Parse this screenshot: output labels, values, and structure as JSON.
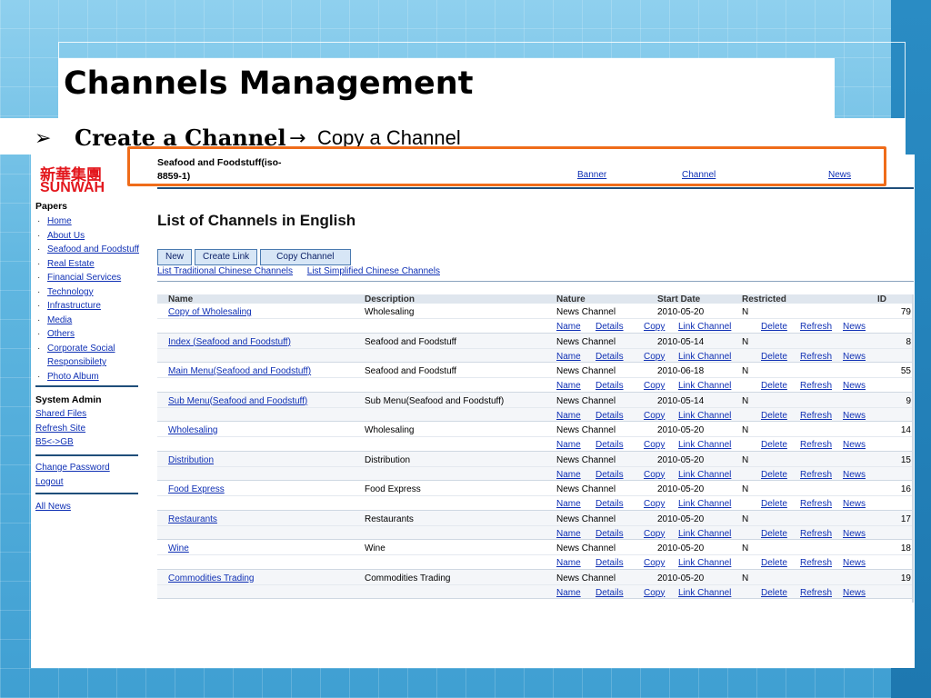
{
  "slide": {
    "title": "Channels Management",
    "bullet_arrow": "➢",
    "bullet_main": "Create a Channel",
    "sub_arrow": "→",
    "bullet_sub": "Copy a Channel"
  },
  "logo": {
    "chinese": "新華集團",
    "english": "SUNWAH"
  },
  "sidebar": {
    "papers_heading": "Papers",
    "papers": [
      "Home",
      "About Us",
      "Seafood and Foodstuff",
      "Real Estate",
      "Financial Services",
      "Technology",
      "Infrastructure",
      "Media",
      "Others"
    ],
    "corporate_1": "Corporate Social",
    "corporate_2": "Responsibilety",
    "photo_album": "Photo Album",
    "system_heading": "System Admin",
    "system_links": [
      "Shared Files",
      "Refresh Site",
      "B5<->GB"
    ],
    "account_links": [
      "Change Password",
      "Logout"
    ],
    "all_news": "All News"
  },
  "header": {
    "paper_title_1": "Seafood and Foodstuff(iso-",
    "paper_title_2": "8859-1)",
    "nav": [
      "Banner",
      "Channel",
      "News"
    ]
  },
  "page": {
    "list_title": "List of Channels in English",
    "buttons": [
      "New",
      "Create Link",
      "Copy Channel"
    ],
    "alt_links": [
      "List Traditional Chinese Channels",
      "List Simplified Chinese Channels"
    ]
  },
  "table": {
    "columns": [
      "Name",
      "Description",
      "Nature",
      "Start Date",
      "Restricted",
      "ID"
    ],
    "actions": [
      "Name",
      "Details",
      "Copy",
      "Link Channel",
      "Delete",
      "Refresh",
      "News"
    ],
    "rows": [
      {
        "name": "Copy of Wholesaling",
        "description": "Wholesaling",
        "nature": "News Channel",
        "start": "2010-05-20",
        "restricted": "N",
        "id": "79"
      },
      {
        "name": "Index (Seafood and Foodstuff)",
        "description": "Seafood and Foodstuff",
        "nature": "News Channel",
        "start": "2010-05-14",
        "restricted": "N",
        "id": "8"
      },
      {
        "name": "Main Menu(Seafood and Foodstuff)",
        "description": "Seafood and Foodstuff",
        "nature": "News Channel",
        "start": "2010-06-18",
        "restricted": "N",
        "id": "55"
      },
      {
        "name": "Sub Menu(Seafood and Foodstuff)",
        "description": "Sub Menu(Seafood and Foodstuff)",
        "nature": "News Channel",
        "start": "2010-05-14",
        "restricted": "N",
        "id": "9"
      },
      {
        "name": "Wholesaling",
        "description": "Wholesaling",
        "nature": "News Channel",
        "start": "2010-05-20",
        "restricted": "N",
        "id": "14"
      },
      {
        "name": "Distribution",
        "description": "Distribution",
        "nature": "News Channel",
        "start": "2010-05-20",
        "restricted": "N",
        "id": "15"
      },
      {
        "name": "Food Express",
        "description": "Food Express",
        "nature": "News Channel",
        "start": "2010-05-20",
        "restricted": "N",
        "id": "16"
      },
      {
        "name": "Restaurants",
        "description": "Restaurants",
        "nature": "News Channel",
        "start": "2010-05-20",
        "restricted": "N",
        "id": "17"
      },
      {
        "name": "Wine",
        "description": "Wine",
        "nature": "News Channel",
        "start": "2010-05-20",
        "restricted": "N",
        "id": "18"
      },
      {
        "name": "Commodities Trading",
        "description": "Commodities Trading",
        "nature": "News Channel",
        "start": "2010-05-20",
        "restricted": "N",
        "id": "19"
      }
    ]
  },
  "colors": {
    "highlight": "#ef6c1a",
    "link": "#0e2fb4",
    "logo": "#e3171d",
    "rule": "#1f4e7a"
  }
}
